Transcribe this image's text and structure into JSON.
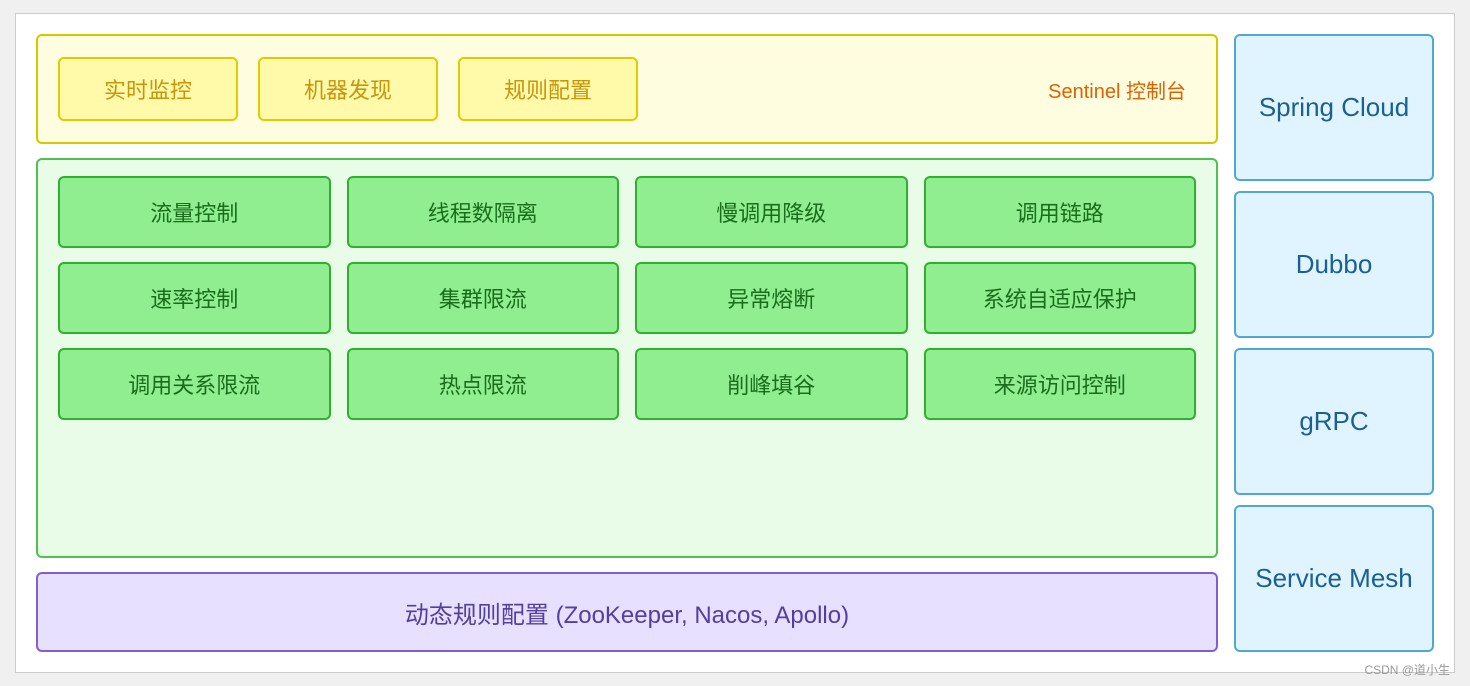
{
  "sentinel": {
    "items": [
      "实时监控",
      "机器发现",
      "规则配置"
    ],
    "label": "Sentinel 控制台"
  },
  "features": {
    "row1": [
      "流量控制",
      "线程数隔离",
      "慢调用降级",
      "调用链路"
    ],
    "row2": [
      "速率控制",
      "集群限流",
      "异常熔断",
      "系统自适应保护"
    ],
    "row3": [
      "调用关系限流",
      "热点限流",
      "削峰填谷",
      "来源访问控制"
    ]
  },
  "dynamic": {
    "label": "动态规则配置 (ZooKeeper, Nacos, Apollo)"
  },
  "right": {
    "items": [
      "Spring Cloud",
      "Dubbo",
      "gRPC",
      "Service Mesh"
    ]
  },
  "watermark": "CSDN @道小生"
}
